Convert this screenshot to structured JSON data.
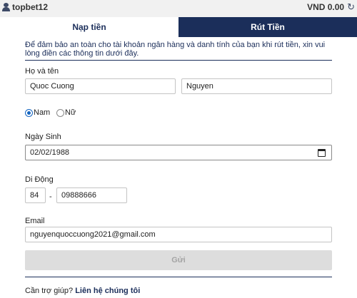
{
  "header": {
    "username": "topbet12",
    "balance": "VND 0.00",
    "user_icon": "user-icon",
    "refresh_icon": "refresh-icon"
  },
  "tabs": [
    {
      "label": "Nạp tiền",
      "active": false
    },
    {
      "label": "Rút Tiền",
      "active": true
    }
  ],
  "form": {
    "notice": "Để đảm bảo an toàn cho tài khoản ngân hàng và danh tính của bạn khi rút tiền, xin vui lòng điền các thông tin dưới đây.",
    "name": {
      "label": "Họ và tên",
      "first_value": "Quoc Cuong",
      "last_value": "Nguyen"
    },
    "gender": {
      "selected": "Nam",
      "options": [
        "Nam",
        "Nữ"
      ]
    },
    "birthday": {
      "label": "Ngày Sinh",
      "value": "02/02/1988"
    },
    "phone": {
      "label": "Di Động",
      "country_code": "84",
      "separator": "-",
      "number": "09888666"
    },
    "email": {
      "label": "Email",
      "value": "nguyenquoccuong2021@gmail.com"
    },
    "submit_label": "Gửi",
    "help_text": "Cần trợ giúp?",
    "help_link": "Liên hệ chúng tôi"
  },
  "colors": {
    "primary": "#1b2e5a",
    "background": "#f1f1f1",
    "radio_accent": "#1565c0",
    "disabled_button": "#dddddd"
  }
}
